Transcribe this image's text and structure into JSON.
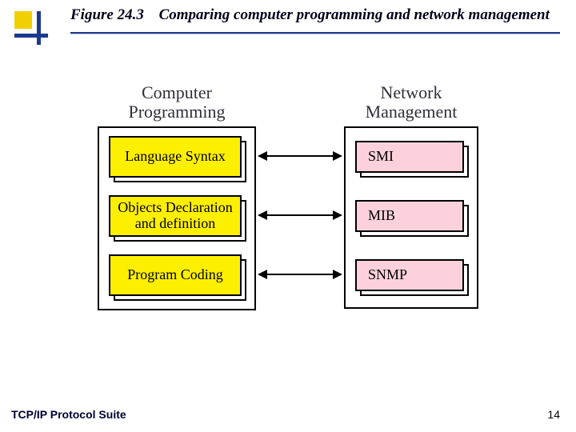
{
  "header": {
    "figure_number": "Figure 24.3",
    "title": "Comparing computer programming and network management"
  },
  "diagram": {
    "left": {
      "heading_line1": "Computer",
      "heading_line2": "Programming",
      "items": [
        "Language Syntax",
        "Objects Declaration and definition",
        "Program Coding"
      ]
    },
    "right": {
      "heading_line1": "Network",
      "heading_line2": "Management",
      "items": [
        "SMI",
        "MIB",
        "SNMP"
      ]
    }
  },
  "footer": {
    "text": "TCP/IP Protocol Suite",
    "page_number": "14"
  }
}
